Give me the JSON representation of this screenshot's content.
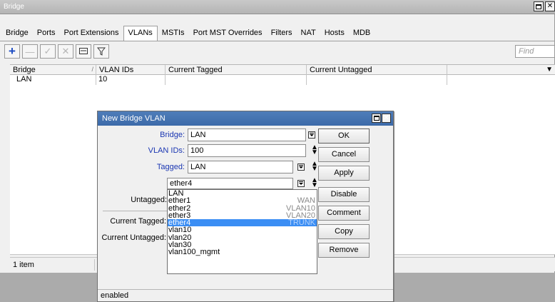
{
  "window": {
    "title": "Bridge"
  },
  "tabs": [
    "Bridge",
    "Ports",
    "Port Extensions",
    "VLANs",
    "MSTIs",
    "Port MST Overrides",
    "Filters",
    "NAT",
    "Hosts",
    "MDB"
  ],
  "active_tab": "VLANs",
  "toolbar": {
    "find_placeholder": "Find"
  },
  "table": {
    "columns": [
      "Bridge",
      "VLAN IDs",
      "Current Tagged",
      "Current Untagged"
    ],
    "rows": [
      {
        "bridge": "LAN",
        "vlan_ids": "10",
        "current_tagged": "",
        "current_untagged": ""
      }
    ]
  },
  "status": {
    "count": "1 item"
  },
  "dialog": {
    "title": "New Bridge VLAN",
    "bridge_label": "Bridge:",
    "bridge_value": "LAN",
    "vlan_ids_label": "VLAN IDs:",
    "vlan_ids_value": "100",
    "tagged_label": "Tagged:",
    "tagged_value": "LAN",
    "tagged_value_2": "ether4",
    "untagged_label": "Untagged:",
    "current_tagged_label": "Current Tagged:",
    "current_untagged_label": "Current Untagged:",
    "buttons": [
      "OK",
      "Cancel",
      "Apply",
      "Disable",
      "Comment",
      "Copy",
      "Remove"
    ],
    "status": "enabled"
  },
  "dropdown": {
    "options": [
      {
        "name": "LAN",
        "note": ""
      },
      {
        "name": "ether1",
        "note": "WAN"
      },
      {
        "name": "ether2",
        "note": "VLAN10"
      },
      {
        "name": "ether3",
        "note": "VLAN20"
      },
      {
        "name": "ether4",
        "note": "TRUNK"
      },
      {
        "name": "vlan10",
        "note": ""
      },
      {
        "name": "vlan20",
        "note": ""
      },
      {
        "name": "vlan30",
        "note": ""
      },
      {
        "name": "vlan100_mgmt",
        "note": ""
      }
    ],
    "selected": "ether4"
  },
  "colors": {
    "dialog_title": "#4172b3",
    "label_blue": "#1a36b2",
    "selection": "#3b8ef4"
  }
}
